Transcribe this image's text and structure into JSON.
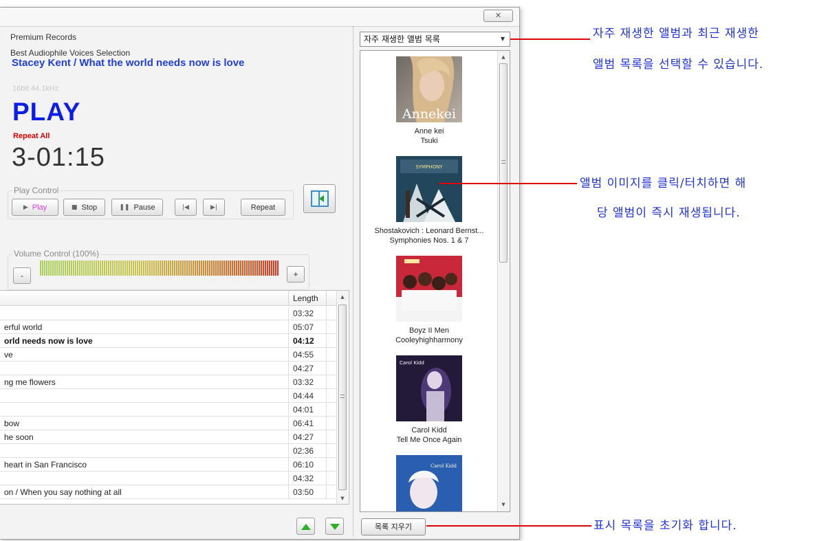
{
  "window": {
    "close_glyph": "✕"
  },
  "info": {
    "label": "Premium Records",
    "album": "Best Audiophile Voices Selection",
    "now_playing": "Stacey Kent / What the world needs now is love",
    "quality": "16bit 44.1kHz",
    "state": "PLAY",
    "repeat_mode": "Repeat All",
    "time": "3-01:15"
  },
  "play_control": {
    "title": "Play Control",
    "play": "Play",
    "stop": "Stop",
    "pause": "Pause",
    "prev_icon": "skip-back-icon",
    "next_icon": "skip-forward-icon",
    "repeat": "Repeat",
    "panel_toggle_icon": "panel-collapse-icon"
  },
  "volume": {
    "title": "Volume Control (100%)",
    "minus": "-",
    "plus": "+",
    "level_percent": 100
  },
  "tracklist": {
    "header_length": "Length",
    "rows": [
      {
        "title": "",
        "length": "03:32",
        "current": false
      },
      {
        "title": "erful world",
        "length": "05:07",
        "current": false
      },
      {
        "title": "orld needs now is love",
        "length": "04:12",
        "current": true
      },
      {
        "title": "ve",
        "length": "04:55",
        "current": false
      },
      {
        "title": "",
        "length": "04:27",
        "current": false
      },
      {
        "title": "ng me flowers",
        "length": "03:32",
        "current": false
      },
      {
        "title": "",
        "length": "04:44",
        "current": false
      },
      {
        "title": "",
        "length": "04:01",
        "current": false
      },
      {
        "title": "bow",
        "length": "06:41",
        "current": false
      },
      {
        "title": "he soon",
        "length": "04:27",
        "current": false
      },
      {
        "title": "",
        "length": "02:36",
        "current": false
      },
      {
        "title": "heart in San Francisco",
        "length": "06:10",
        "current": false
      },
      {
        "title": "",
        "length": "04:32",
        "current": false
      },
      {
        "title": "on / When you say nothing at all",
        "length": "03:50",
        "current": false
      }
    ]
  },
  "album_panel": {
    "select_value": "자주 재생한 앨범 목록",
    "clear_button": "목록 지우기",
    "albums": [
      {
        "artist": "Anne kei",
        "title": "Tsuki",
        "cover_text": "Annekei"
      },
      {
        "artist": "Shostakovich : Leonard Bernst...",
        "title": "Symphonies Nos. 1 & 7",
        "cover_text": "SYMPHONY"
      },
      {
        "artist": "Boyz II Men",
        "title": "Cooleyhighharmony",
        "cover_text": ""
      },
      {
        "artist": "Carol Kidd",
        "title": "Tell Me Once Again",
        "cover_text": "Carol Kidd"
      },
      {
        "artist": "",
        "title": "",
        "cover_text": "Carol Kidd"
      }
    ]
  },
  "annotations": {
    "select_line1": "자주 재생한 앨범과 최근 재생한",
    "select_line2": "앨범 목록을 선택할 수 있습니다.",
    "cover_line1": "앨범 이미지를 클릭/터치하면 해",
    "cover_line2": "당 앨범이 즉시 재생됩니다.",
    "clear_line": "표시 목록을 초기화 합니다.",
    "line_color": "#e10000",
    "text_color": "#1f33d8"
  },
  "colors": {
    "now_playing": "#1f3fd6",
    "state": "#0b1ee8",
    "repeat": "#e00000",
    "play_label": "#e23ce2",
    "arrow_green": "#2fae2a"
  }
}
